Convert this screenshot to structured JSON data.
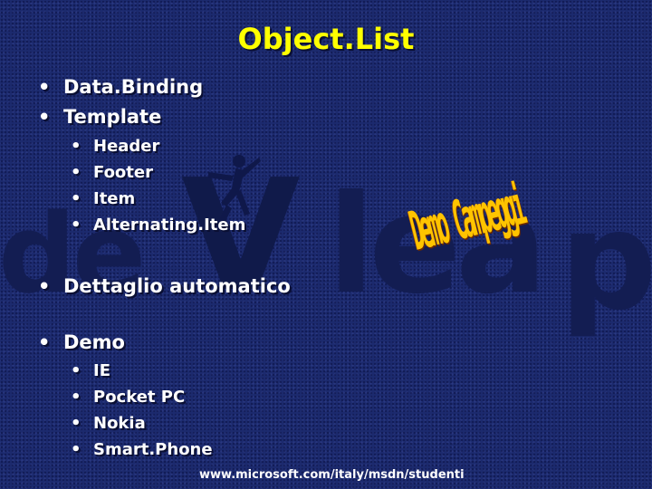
{
  "slide": {
    "title": "Object.List",
    "watermark": {
      "part1": "de",
      "part2": "V",
      "part3": "lea",
      "part4": "p"
    },
    "bullet": "•",
    "items": [
      {
        "text": "Data.Binding",
        "level": 1
      },
      {
        "text": "Template",
        "level": 1
      },
      {
        "text": "Header",
        "level": 2
      },
      {
        "text": "Footer",
        "level": 2
      },
      {
        "text": "Item",
        "level": 2
      },
      {
        "text": "Alternating.Item",
        "level": 2
      },
      {
        "text": "Dettaglio automatico",
        "level": 1
      },
      {
        "text": "Demo",
        "level": 1
      },
      {
        "text": "IE",
        "level": 2
      },
      {
        "text": "Pocket PC",
        "level": 2
      },
      {
        "text": "Nokia",
        "level": 2
      },
      {
        "text": "Smart.Phone",
        "level": 2
      }
    ],
    "sticker": "Demo Campeggi",
    "footer_url": "www.microsoft.com/italy/msdn/studenti"
  },
  "colors": {
    "background": "#1c2a6e",
    "title": "#ffff00",
    "text": "#ffffff",
    "sticker": "#ffc400",
    "watermark": "#131d52"
  },
  "icons": [
    "figure-silhouette-icon"
  ]
}
